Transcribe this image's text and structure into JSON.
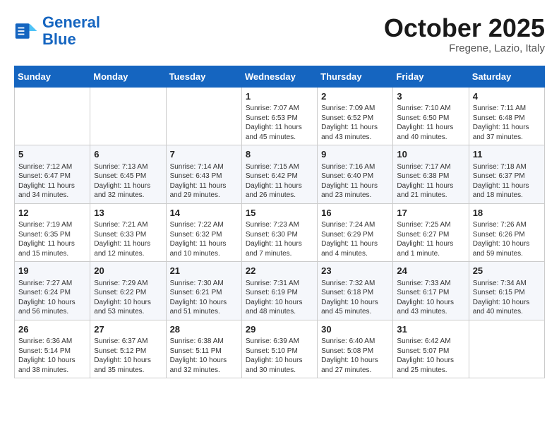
{
  "header": {
    "logo_line1": "General",
    "logo_line2": "Blue",
    "month_title": "October 2025",
    "location": "Fregene, Lazio, Italy"
  },
  "days_of_week": [
    "Sunday",
    "Monday",
    "Tuesday",
    "Wednesday",
    "Thursday",
    "Friday",
    "Saturday"
  ],
  "weeks": [
    [
      {
        "day": "",
        "info": ""
      },
      {
        "day": "",
        "info": ""
      },
      {
        "day": "",
        "info": ""
      },
      {
        "day": "1",
        "info": "Sunrise: 7:07 AM\nSunset: 6:53 PM\nDaylight: 11 hours and 45 minutes."
      },
      {
        "day": "2",
        "info": "Sunrise: 7:09 AM\nSunset: 6:52 PM\nDaylight: 11 hours and 43 minutes."
      },
      {
        "day": "3",
        "info": "Sunrise: 7:10 AM\nSunset: 6:50 PM\nDaylight: 11 hours and 40 minutes."
      },
      {
        "day": "4",
        "info": "Sunrise: 7:11 AM\nSunset: 6:48 PM\nDaylight: 11 hours and 37 minutes."
      }
    ],
    [
      {
        "day": "5",
        "info": "Sunrise: 7:12 AM\nSunset: 6:47 PM\nDaylight: 11 hours and 34 minutes."
      },
      {
        "day": "6",
        "info": "Sunrise: 7:13 AM\nSunset: 6:45 PM\nDaylight: 11 hours and 32 minutes."
      },
      {
        "day": "7",
        "info": "Sunrise: 7:14 AM\nSunset: 6:43 PM\nDaylight: 11 hours and 29 minutes."
      },
      {
        "day": "8",
        "info": "Sunrise: 7:15 AM\nSunset: 6:42 PM\nDaylight: 11 hours and 26 minutes."
      },
      {
        "day": "9",
        "info": "Sunrise: 7:16 AM\nSunset: 6:40 PM\nDaylight: 11 hours and 23 minutes."
      },
      {
        "day": "10",
        "info": "Sunrise: 7:17 AM\nSunset: 6:38 PM\nDaylight: 11 hours and 21 minutes."
      },
      {
        "day": "11",
        "info": "Sunrise: 7:18 AM\nSunset: 6:37 PM\nDaylight: 11 hours and 18 minutes."
      }
    ],
    [
      {
        "day": "12",
        "info": "Sunrise: 7:19 AM\nSunset: 6:35 PM\nDaylight: 11 hours and 15 minutes."
      },
      {
        "day": "13",
        "info": "Sunrise: 7:21 AM\nSunset: 6:33 PM\nDaylight: 11 hours and 12 minutes."
      },
      {
        "day": "14",
        "info": "Sunrise: 7:22 AM\nSunset: 6:32 PM\nDaylight: 11 hours and 10 minutes."
      },
      {
        "day": "15",
        "info": "Sunrise: 7:23 AM\nSunset: 6:30 PM\nDaylight: 11 hours and 7 minutes."
      },
      {
        "day": "16",
        "info": "Sunrise: 7:24 AM\nSunset: 6:29 PM\nDaylight: 11 hours and 4 minutes."
      },
      {
        "day": "17",
        "info": "Sunrise: 7:25 AM\nSunset: 6:27 PM\nDaylight: 11 hours and 1 minute."
      },
      {
        "day": "18",
        "info": "Sunrise: 7:26 AM\nSunset: 6:26 PM\nDaylight: 10 hours and 59 minutes."
      }
    ],
    [
      {
        "day": "19",
        "info": "Sunrise: 7:27 AM\nSunset: 6:24 PM\nDaylight: 10 hours and 56 minutes."
      },
      {
        "day": "20",
        "info": "Sunrise: 7:29 AM\nSunset: 6:22 PM\nDaylight: 10 hours and 53 minutes."
      },
      {
        "day": "21",
        "info": "Sunrise: 7:30 AM\nSunset: 6:21 PM\nDaylight: 10 hours and 51 minutes."
      },
      {
        "day": "22",
        "info": "Sunrise: 7:31 AM\nSunset: 6:19 PM\nDaylight: 10 hours and 48 minutes."
      },
      {
        "day": "23",
        "info": "Sunrise: 7:32 AM\nSunset: 6:18 PM\nDaylight: 10 hours and 45 minutes."
      },
      {
        "day": "24",
        "info": "Sunrise: 7:33 AM\nSunset: 6:17 PM\nDaylight: 10 hours and 43 minutes."
      },
      {
        "day": "25",
        "info": "Sunrise: 7:34 AM\nSunset: 6:15 PM\nDaylight: 10 hours and 40 minutes."
      }
    ],
    [
      {
        "day": "26",
        "info": "Sunrise: 6:36 AM\nSunset: 5:14 PM\nDaylight: 10 hours and 38 minutes."
      },
      {
        "day": "27",
        "info": "Sunrise: 6:37 AM\nSunset: 5:12 PM\nDaylight: 10 hours and 35 minutes."
      },
      {
        "day": "28",
        "info": "Sunrise: 6:38 AM\nSunset: 5:11 PM\nDaylight: 10 hours and 32 minutes."
      },
      {
        "day": "29",
        "info": "Sunrise: 6:39 AM\nSunset: 5:10 PM\nDaylight: 10 hours and 30 minutes."
      },
      {
        "day": "30",
        "info": "Sunrise: 6:40 AM\nSunset: 5:08 PM\nDaylight: 10 hours and 27 minutes."
      },
      {
        "day": "31",
        "info": "Sunrise: 6:42 AM\nSunset: 5:07 PM\nDaylight: 10 hours and 25 minutes."
      },
      {
        "day": "",
        "info": ""
      }
    ]
  ]
}
